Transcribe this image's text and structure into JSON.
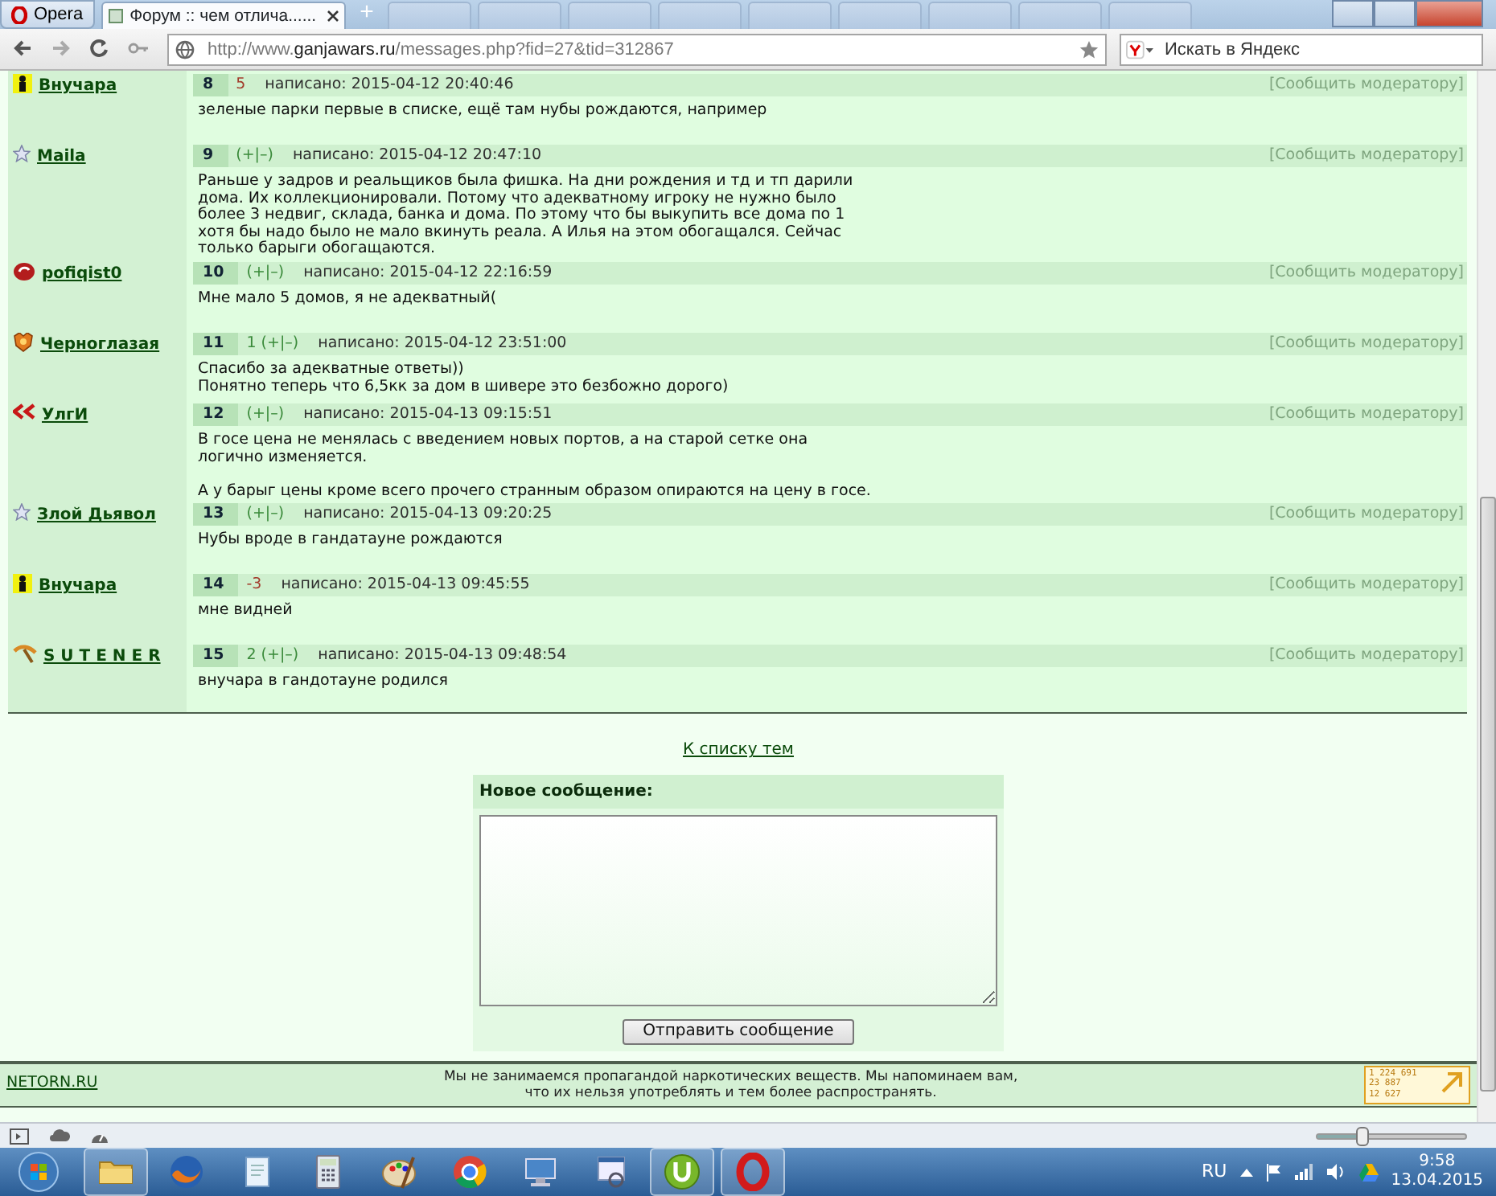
{
  "browser": {
    "menu_label": "Opera",
    "tabs": [
      {
        "kind": "page",
        "title": "Форум :: чем отлича......",
        "selected": true
      },
      {
        "kind": "blurred",
        "selected": false
      },
      {
        "kind": "blurred",
        "selected": false
      },
      {
        "kind": "blurred",
        "selected": false
      },
      {
        "kind": "blurred",
        "selected": false
      },
      {
        "kind": "blurred",
        "selected": false
      },
      {
        "kind": "blurred",
        "selected": false
      },
      {
        "kind": "blurred",
        "selected": false
      },
      {
        "kind": "blurred",
        "selected": false
      },
      {
        "kind": "blurred",
        "selected": false
      }
    ],
    "new_tab": "+",
    "address": {
      "prefix": "http://www.",
      "domain": "ganjawars.ru",
      "rest": "/messages.php?fid=27&tid=312867"
    },
    "search": {
      "placeholder": "Искать в Яндекс"
    }
  },
  "posts": [
    {
      "author": "Внучара",
      "number": "8",
      "rating": "5",
      "negative": true,
      "date": "написано: 2015-04-12 20:40:46",
      "report": "[Сообщить модератору]",
      "paragraphs": [
        [
          "зеленые парки первые в списке, ещё там нубы рождаются, например"
        ]
      ]
    },
    {
      "author": "Maila",
      "number": "9",
      "rating": "(+|–)",
      "negative": false,
      "date": "написано: 2015-04-12 20:47:10",
      "report": "[Сообщить модератору]",
      "paragraphs": [
        [
          "Раньше у задров и реальщиков была фишка. На дни рождения и тд и тп дарили дома. Их коллекционировали. Потому что адекватному игроку не нужно было более 3 недвиг, склада, банка и дома. По этому что бы выкупить все дома по 1 хотя бы надо было не мало вкинуть реала. А Илья на этом обогащался. Сейчас только барыги обогащаются."
        ]
      ]
    },
    {
      "author": "pofiqist0",
      "number": "10",
      "rating": "(+|–)",
      "negative": false,
      "date": "написано: 2015-04-12 22:16:59",
      "report": "[Сообщить модератору]",
      "paragraphs": [
        [
          "Мне мало 5 домов, я не адекватный("
        ]
      ]
    },
    {
      "author": "Черноглазая",
      "number": "11",
      "rating": "1 (+|–)",
      "negative": false,
      "date": "написано: 2015-04-12 23:51:00",
      "report": "[Сообщить модератору]",
      "paragraphs": [
        [
          "Спасибо за адекватные ответы))",
          "Понятно теперь что 6,5кк за дом в шивере это безбожно дорого)"
        ]
      ]
    },
    {
      "author": "УлгИ",
      "number": "12",
      "rating": "(+|–)",
      "negative": false,
      "date": "написано: 2015-04-13 09:15:51",
      "report": "[Сообщить модератору]",
      "paragraphs": [
        [
          "В госе цена не менялась с введением новых портов, а на старой сетке она логично изменяется."
        ],
        [
          "А у барыг цены кроме всего прочего странным образом опираются на цену в госе."
        ]
      ]
    },
    {
      "author": "Злой Дьявол",
      "number": "13",
      "rating": "(+|–)",
      "negative": false,
      "date": "написано: 2015-04-13 09:20:25",
      "report": "[Сообщить модератору]",
      "paragraphs": [
        [
          "Нубы вроде в гандатауне рождаются"
        ]
      ]
    },
    {
      "author": "Внучара",
      "number": "14",
      "rating": "-3",
      "negative": true,
      "date": "написано: 2015-04-13 09:45:55",
      "report": "[Сообщить модератору]",
      "paragraphs": [
        [
          "мне видней"
        ]
      ]
    },
    {
      "author": "S U T E N E R",
      "number": "15",
      "rating": "2 (+|–)",
      "negative": false,
      "date": "написано: 2015-04-13 09:48:54",
      "report": "[Сообщить модератору]",
      "paragraphs": [
        [
          "внучара в гандотауне родился"
        ]
      ]
    }
  ],
  "back_link": "К списку тем",
  "reply_form": {
    "title": "Новое сообщение:",
    "submit": "Отправить сообщение"
  },
  "footer": {
    "site_link": "NETORN.RU",
    "notice": "Мы не занимаемся пропагандой наркотических веществ. Мы напоминаем вам, что их нельзя употреблять и тем более распространять.",
    "counter": [
      "1 224 691",
      "23 887",
      "12 627"
    ]
  },
  "status_bar": {
    "zoom": {
      "level": 0.3
    }
  },
  "taskbar": {
    "apps": [
      {
        "running": true
      },
      {
        "running": false
      },
      {
        "running": false
      },
      {
        "running": false
      },
      {
        "running": false
      },
      {
        "running": false
      },
      {
        "running": false
      },
      {
        "running": false
      },
      {
        "running": true
      },
      {
        "running": true
      }
    ],
    "language": "RU",
    "time": "9:58",
    "date": "13.04.2015"
  }
}
